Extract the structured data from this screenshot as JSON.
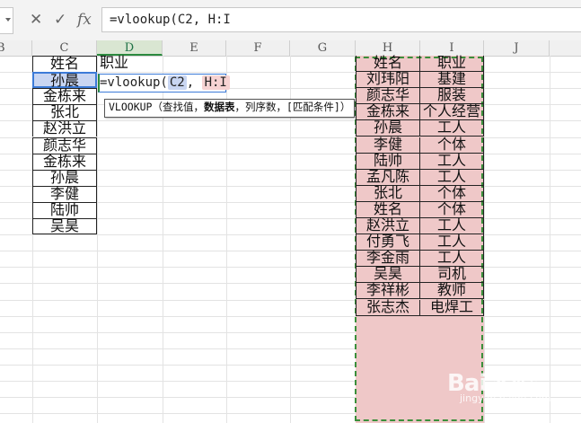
{
  "formula_bar": {
    "cancel_icon": "x-icon",
    "confirm_icon": "check-icon",
    "fx_label": "fx",
    "formula": "=vlookup(C2, H:I"
  },
  "columns": [
    "B",
    "C",
    "D",
    "E",
    "F",
    "G",
    "H",
    "I",
    "J"
  ],
  "column_c": [
    "姓名",
    "孙晨",
    "金栋来",
    "张北",
    "赵洪立",
    "颜志华",
    "金栋来",
    "孙晨",
    "李健",
    "陆帅",
    "吴昊"
  ],
  "d1": "职业",
  "editing": {
    "prefix": "=vlookup(",
    "ref1": "C2",
    "sep": ", ",
    "ref2": "H:I"
  },
  "tooltip": {
    "func": "VLOOKUP",
    "p1": "（查找值，",
    "p2": "数据表",
    "p3": "，列序数，[匹配条件]）"
  },
  "lookup_table": {
    "h": [
      "姓名",
      "刘玮阳",
      "颜志华",
      "金栋来",
      "孙晨",
      "李健",
      "陆帅",
      "孟凡陈",
      "张北",
      "姓名",
      "赵洪立",
      "付勇飞",
      "李金雨",
      "吴昊",
      "李祥彬",
      "张志杰"
    ],
    "i": [
      "职业",
      "基建",
      "服装",
      "个人经营",
      "工人",
      "个体",
      "工人",
      "工人",
      "个体",
      "个体",
      "工人",
      "工人",
      "工人",
      "司机",
      "教师",
      "电焊工"
    ]
  },
  "watermark": {
    "main": "Bai 经验",
    "sub": "jingyan.baidu.com"
  },
  "colors": {
    "selection_pink": "#efc8c8",
    "active_green": "#2b8a3e",
    "ref_blue": "#c9d6f2"
  }
}
